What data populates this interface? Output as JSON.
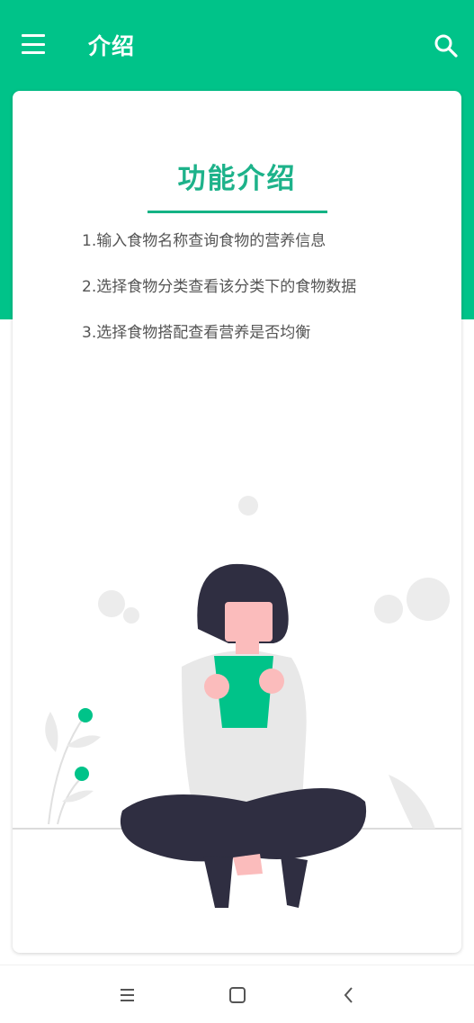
{
  "app_bar": {
    "title": "介绍",
    "menu_icon": "hamburger-menu-icon",
    "search_icon": "search-icon",
    "background_color": "#00c389"
  },
  "card": {
    "title": "功能介绍",
    "title_color": "#1db28a",
    "features": [
      "1.输入食物名称查询食物的营养信息",
      "2.选择食物分类查看该分类下的食物数据",
      "3.选择食物搭配查看营养是否均衡"
    ]
  },
  "system_nav": {
    "recents_icon": "recents-icon",
    "home_icon": "home-icon",
    "back_icon": "back-icon"
  }
}
